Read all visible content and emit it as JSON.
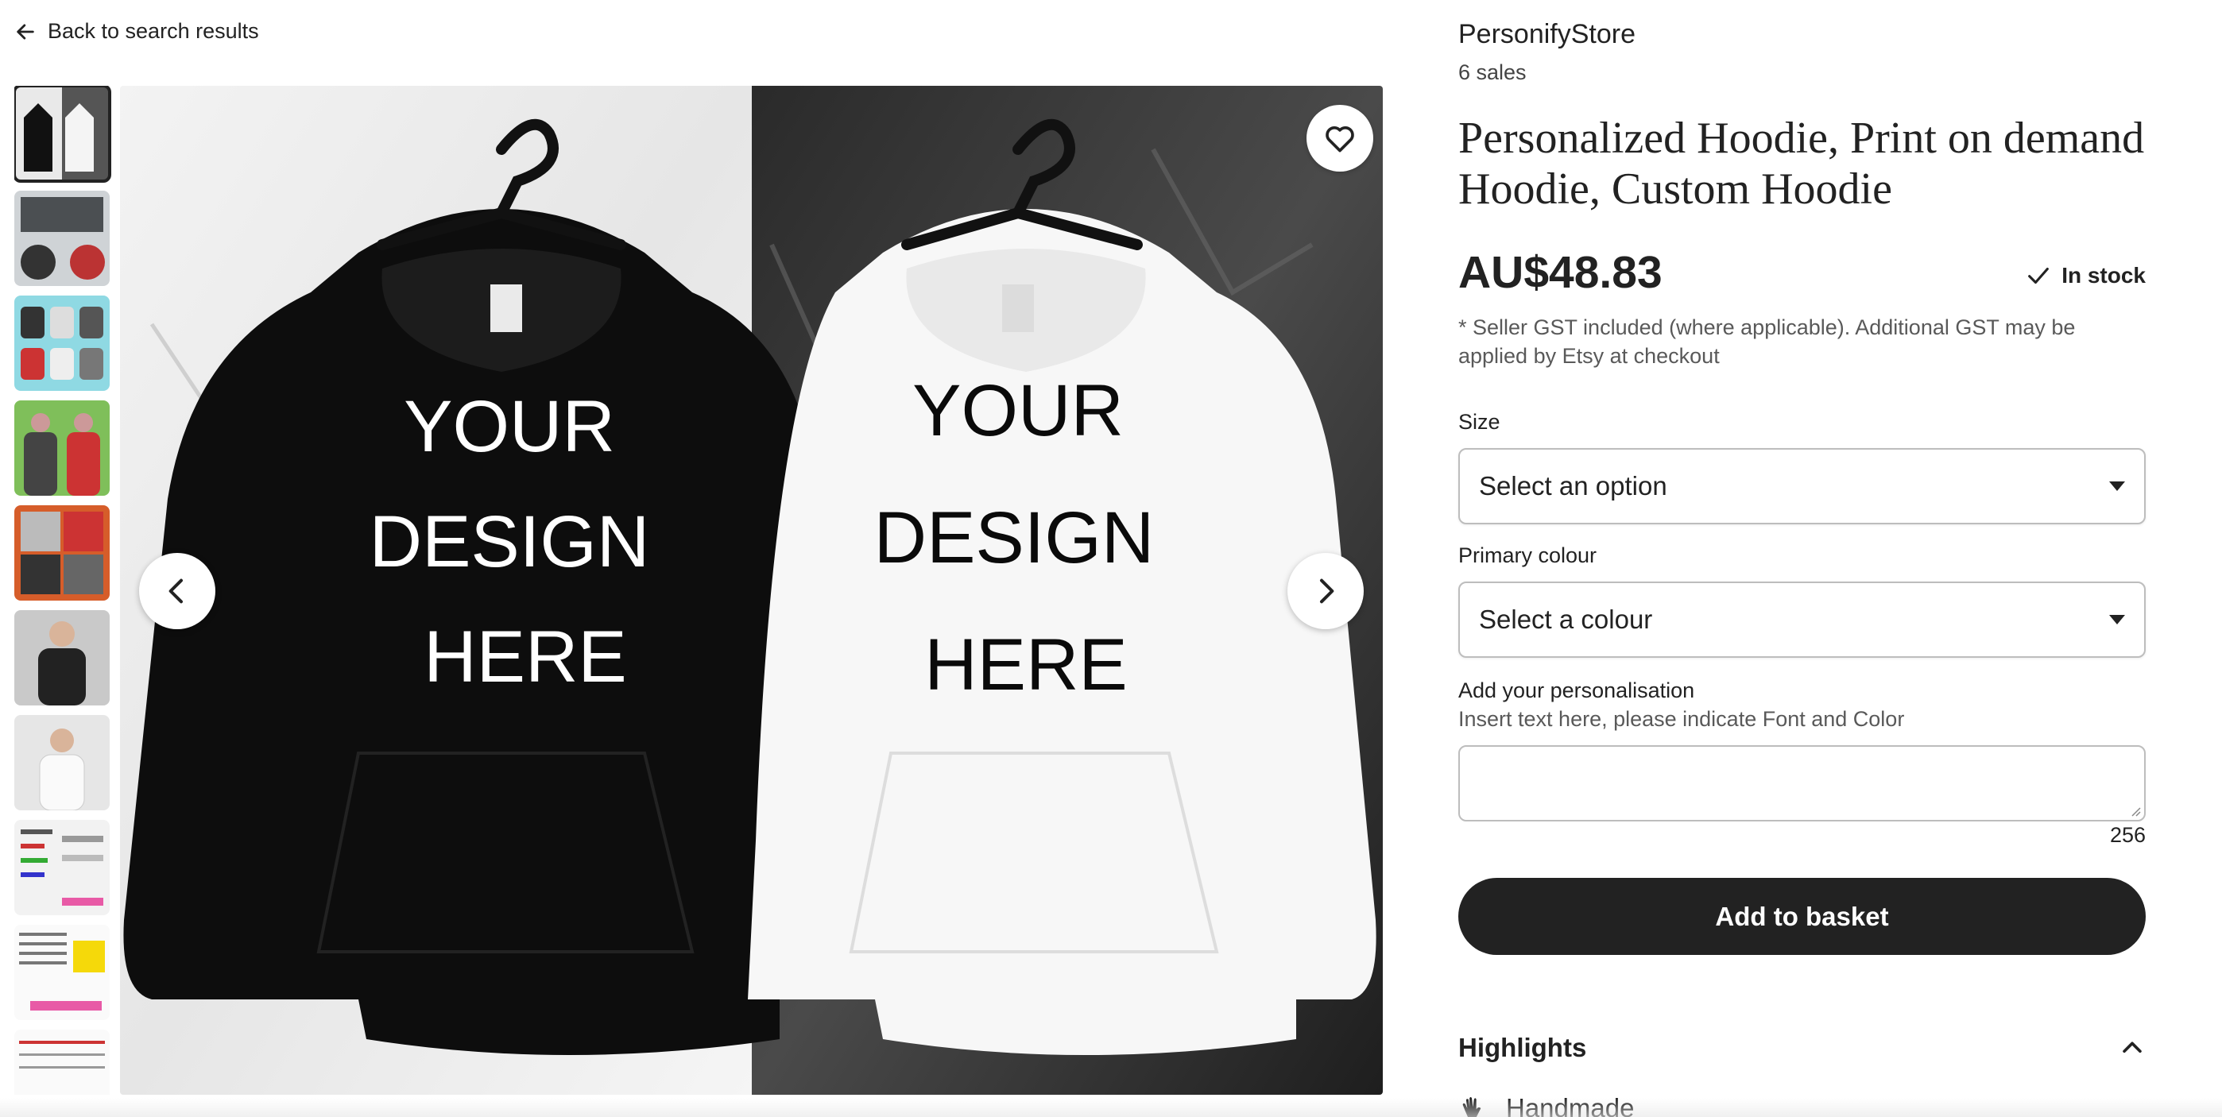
{
  "nav": {
    "back_label": "Back to search results"
  },
  "gallery": {
    "thumbnails": [
      {
        "name": "thumbnail-black-white-hoodies"
      },
      {
        "name": "thumbnail-design-your-own"
      },
      {
        "name": "thumbnail-colour-hoodies"
      },
      {
        "name": "thumbnail-couple-green"
      },
      {
        "name": "thumbnail-hoodie-collage"
      },
      {
        "name": "thumbnail-man-black-hoodie"
      },
      {
        "name": "thumbnail-woman-white-hoodie"
      },
      {
        "name": "thumbnail-font-colours"
      },
      {
        "name": "thumbnail-font-chart"
      },
      {
        "name": "thumbnail-sizing-info"
      }
    ],
    "main_image": {
      "left_print": [
        "YOUR",
        "DESIGN",
        "HERE"
      ],
      "right_print": [
        "YOUR",
        "DESIGN",
        "HERE"
      ]
    }
  },
  "listing": {
    "shop_name": "PersonifyStore",
    "sales": "6 sales",
    "title": "Personalized Hoodie, Print on demand Hoodie, Custom Hoodie",
    "price": "AU$48.83",
    "stock": "In stock",
    "gst_note": "* Seller GST included (where applicable). Additional GST may be applied by Etsy at checkout",
    "size": {
      "label": "Size",
      "value": "Select an option"
    },
    "colour": {
      "label": "Primary colour",
      "value": "Select a colour"
    },
    "personalisation": {
      "label": "Add your personalisation",
      "instructions": "Insert text here, please indicate Font and Color",
      "counter": "256"
    },
    "add_to_basket": "Add to basket",
    "highlights": {
      "heading": "Highlights",
      "item": "Handmade"
    }
  },
  "colors": {
    "button": "#222222",
    "text": "#222222",
    "border": "#bdbdbd"
  },
  "icons": [
    "arrow-left-icon",
    "heart-icon",
    "chevron-left-icon",
    "chevron-right-icon",
    "checkmark-icon",
    "caret-down-icon",
    "chevron-up-icon",
    "hand-icon"
  ]
}
